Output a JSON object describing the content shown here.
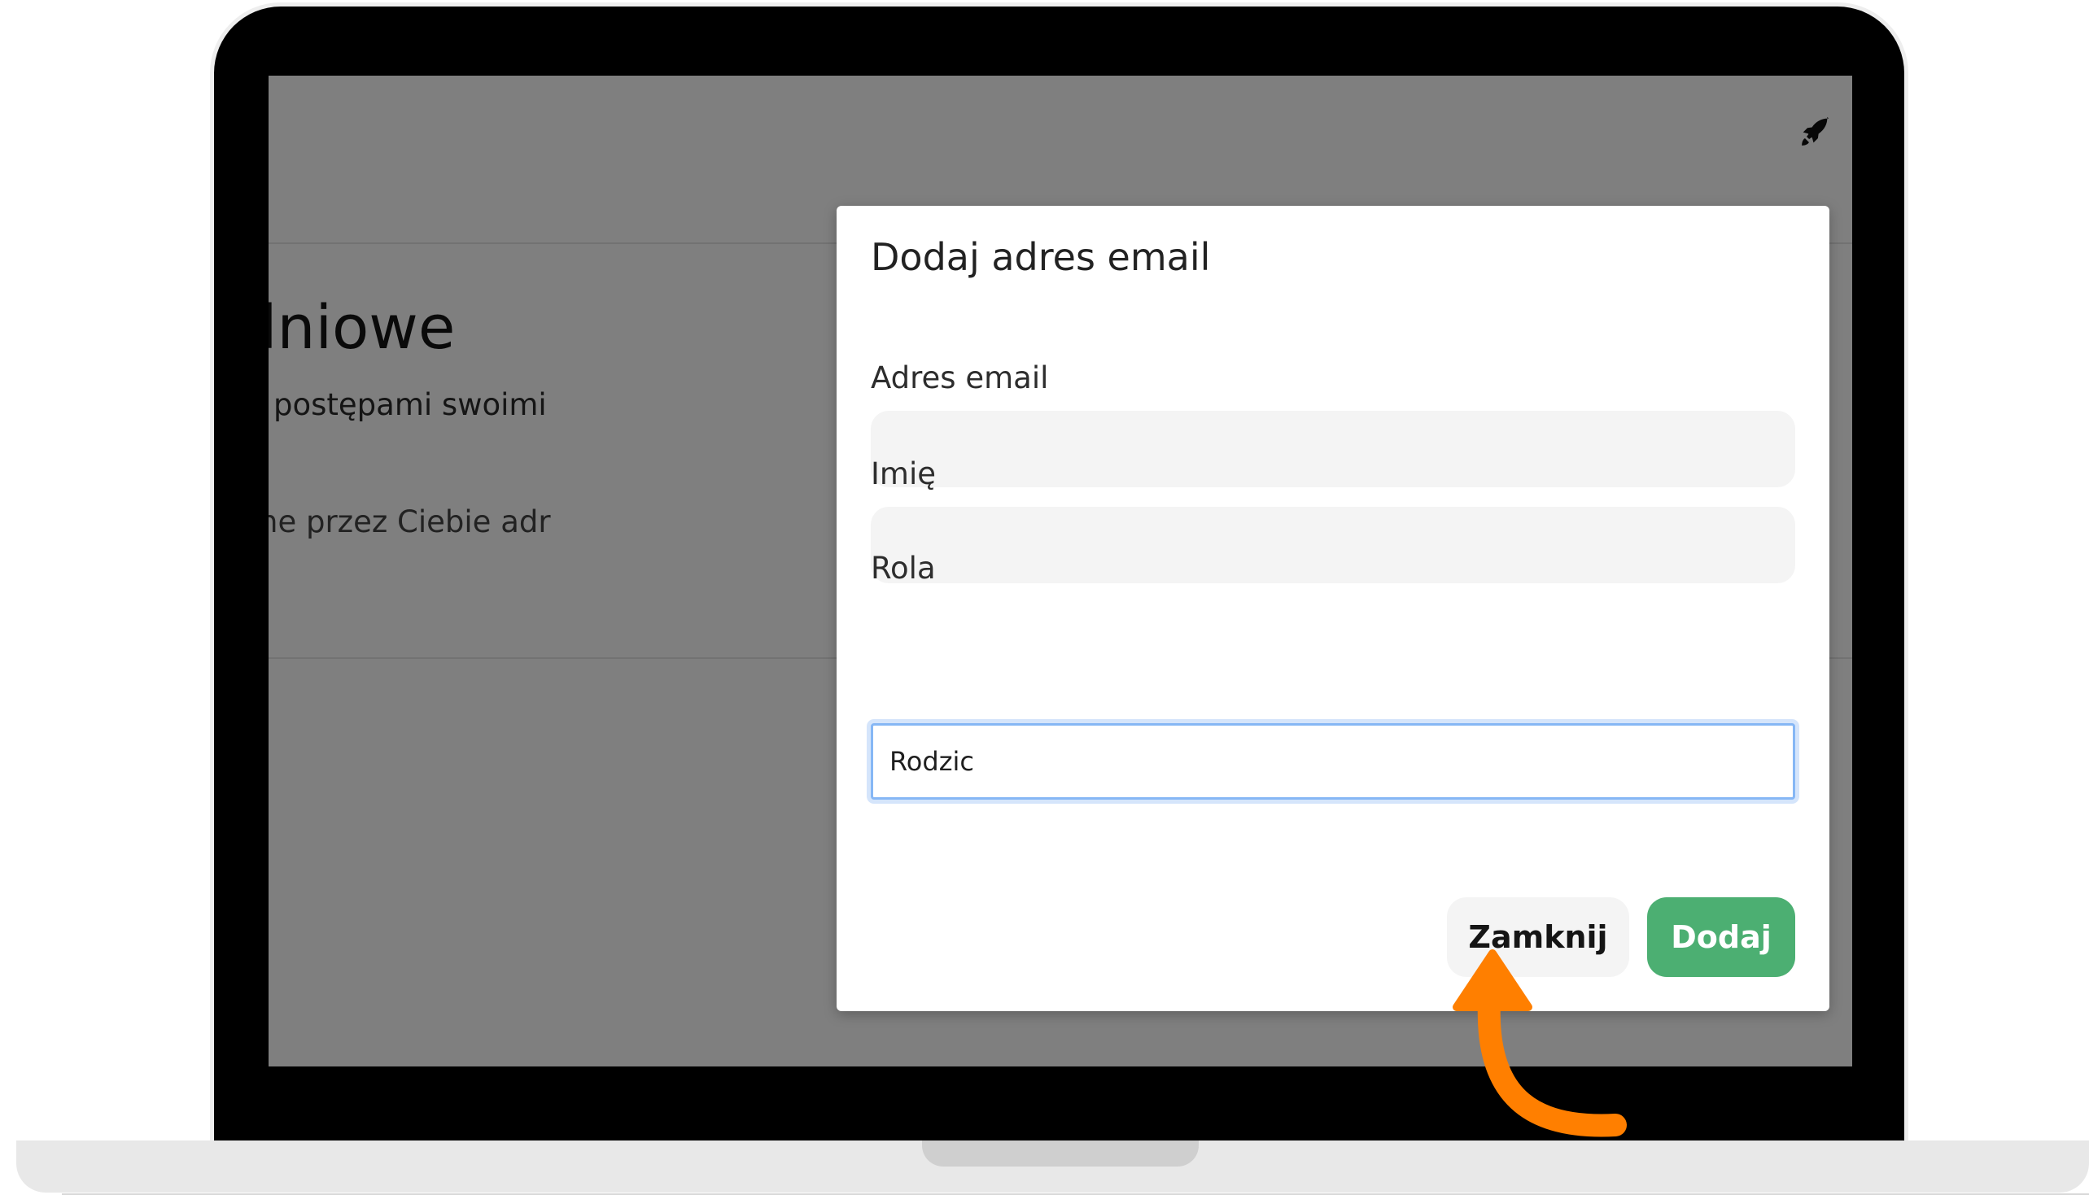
{
  "page": {
    "heading": "lniowe",
    "subtitle": "postępami swoimi",
    "subtitle2": "ne przez Ciebie adr"
  },
  "header": {
    "rocket_icon": "rocket-icon"
  },
  "modal": {
    "title": "Dodaj adres email",
    "email_label": "Adres email",
    "email_value": "",
    "name_label": "Imię",
    "name_value": "",
    "role_label": "Rola",
    "role_value": "Rodzic",
    "close_label": "Zamknij",
    "add_label": "Dodaj"
  },
  "colors": {
    "overlay": "#000000",
    "primary_button": "#4caf72",
    "secondary_button": "#f4f4f4",
    "focus_ring": "#86b7f5",
    "annotation_arrow": "#ff7f00"
  },
  "annotation": {
    "icon": "curved-arrow-icon"
  }
}
